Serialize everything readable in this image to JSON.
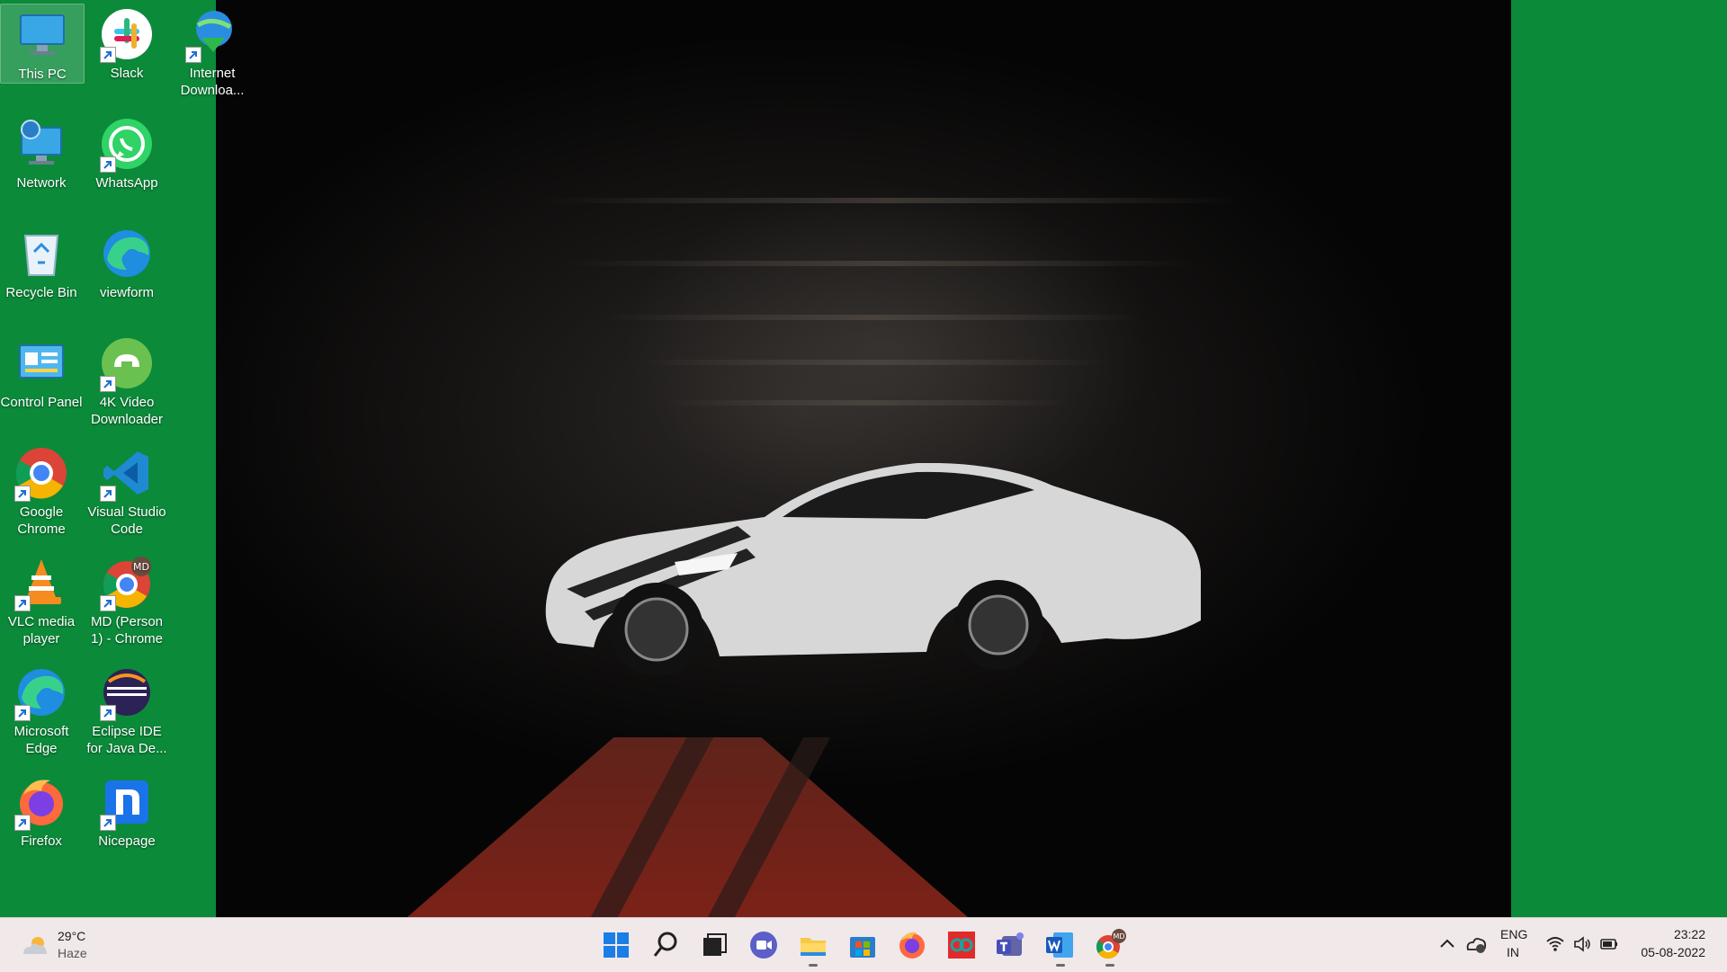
{
  "desktop": {
    "icons": [
      {
        "label": "This PC",
        "icon": "monitor-icon",
        "shortcut": false,
        "selected": true
      },
      {
        "label": "Slack",
        "icon": "slack-icon",
        "shortcut": true
      },
      {
        "label": "Internet Downloa...",
        "icon": "internet-download-manager-icon",
        "shortcut": true
      },
      {
        "label": "Network",
        "icon": "network-icon",
        "shortcut": false
      },
      {
        "label": "WhatsApp",
        "icon": "whatsapp-icon",
        "shortcut": true
      },
      {
        "label": "Recycle Bin",
        "icon": "recycle-bin-icon",
        "shortcut": false
      },
      {
        "label": "viewform",
        "icon": "edge-icon",
        "shortcut": false
      },
      {
        "label": "Control Panel",
        "icon": "control-panel-icon",
        "shortcut": false
      },
      {
        "label": "4K Video Downloader",
        "icon": "4k-video-downloader-icon",
        "shortcut": true
      },
      {
        "label": "Google Chrome",
        "icon": "chrome-icon",
        "shortcut": true
      },
      {
        "label": "Visual Studio Code",
        "icon": "vscode-icon",
        "shortcut": true
      },
      {
        "label": "VLC media player",
        "icon": "vlc-icon",
        "shortcut": true
      },
      {
        "label": "MD (Person 1) - Chrome",
        "icon": "chrome-profile-icon",
        "shortcut": true,
        "badge": "MD"
      },
      {
        "label": "Microsoft Edge",
        "icon": "edge-icon",
        "shortcut": true
      },
      {
        "label": "Eclipse IDE for Java De...",
        "icon": "eclipse-icon",
        "shortcut": true
      },
      {
        "label": "Firefox",
        "icon": "firefox-icon",
        "shortcut": true
      },
      {
        "label": "Nicepage",
        "icon": "nicepage-icon",
        "shortcut": true
      }
    ]
  },
  "taskbar": {
    "weather": {
      "temp": "29°C",
      "condition": "Haze",
      "icon": "weather-haze-icon"
    },
    "apps": [
      {
        "name": "start",
        "icon": "windows-start-icon"
      },
      {
        "name": "search",
        "icon": "search-icon"
      },
      {
        "name": "task-view",
        "icon": "task-view-icon"
      },
      {
        "name": "chat",
        "icon": "teams-chat-icon"
      },
      {
        "name": "file-explorer",
        "icon": "file-explorer-icon",
        "running": true
      },
      {
        "name": "microsoft-store",
        "icon": "store-icon"
      },
      {
        "name": "firefox",
        "icon": "firefox-icon"
      },
      {
        "name": "arduino",
        "icon": "arduino-icon"
      },
      {
        "name": "teams",
        "icon": "teams-icon"
      },
      {
        "name": "word",
        "icon": "word-icon",
        "running": true
      },
      {
        "name": "chrome",
        "icon": "chrome-profile-icon",
        "running": true,
        "badge": "MD"
      }
    ],
    "tray": {
      "language_top": "ENG",
      "language_bottom": "IN",
      "time": "23:22",
      "date": "05-08-2022"
    }
  },
  "colors": {
    "desktop_background": "#0b8a3a",
    "taskbar_background": "#f1e8ea"
  }
}
